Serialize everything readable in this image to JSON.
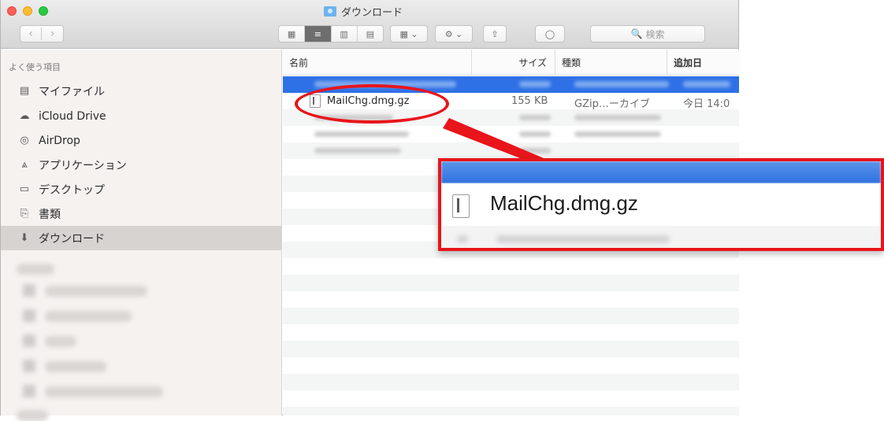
{
  "window": {
    "title": "ダウンロード"
  },
  "toolbar": {
    "back_label": "‹",
    "forward_label": "›",
    "view_icons": [
      "▦",
      "≡",
      "▥",
      "▤"
    ],
    "arrange_label": "▦ ⌄",
    "action_label": "⚙ ⌄",
    "share_label": "⇧",
    "tags_label": "◯",
    "search_placeholder": "検索",
    "search_icon": "🔍"
  },
  "sidebar": {
    "section_title": "よく使う項目",
    "items": [
      {
        "label": "マイファイル",
        "icon": "all-my-files-icon",
        "glyph": "▤"
      },
      {
        "label": "iCloud Drive",
        "icon": "cloud-icon",
        "glyph": "☁"
      },
      {
        "label": "AirDrop",
        "icon": "airdrop-icon",
        "glyph": "◎"
      },
      {
        "label": "アプリケーション",
        "icon": "applications-icon",
        "glyph": "⩓"
      },
      {
        "label": "デスクトップ",
        "icon": "desktop-icon",
        "glyph": "▭"
      },
      {
        "label": "書類",
        "icon": "documents-icon",
        "glyph": "⎘"
      },
      {
        "label": "ダウンロード",
        "icon": "downloads-icon",
        "glyph": "⬇"
      }
    ],
    "selected_index": 6
  },
  "columns": {
    "name": "名前",
    "size": "サイズ",
    "kind": "種類",
    "date": "追加日"
  },
  "file": {
    "name": "MailChg.dmg.gz",
    "size": "155 KB",
    "kind": "GZip…ーカイブ",
    "date": "今日 14:0"
  },
  "zoom": {
    "name": "MailChg.dmg.gz"
  },
  "colors": {
    "highlight_red": "#e8151b",
    "selection_blue": "#2e71e6"
  }
}
